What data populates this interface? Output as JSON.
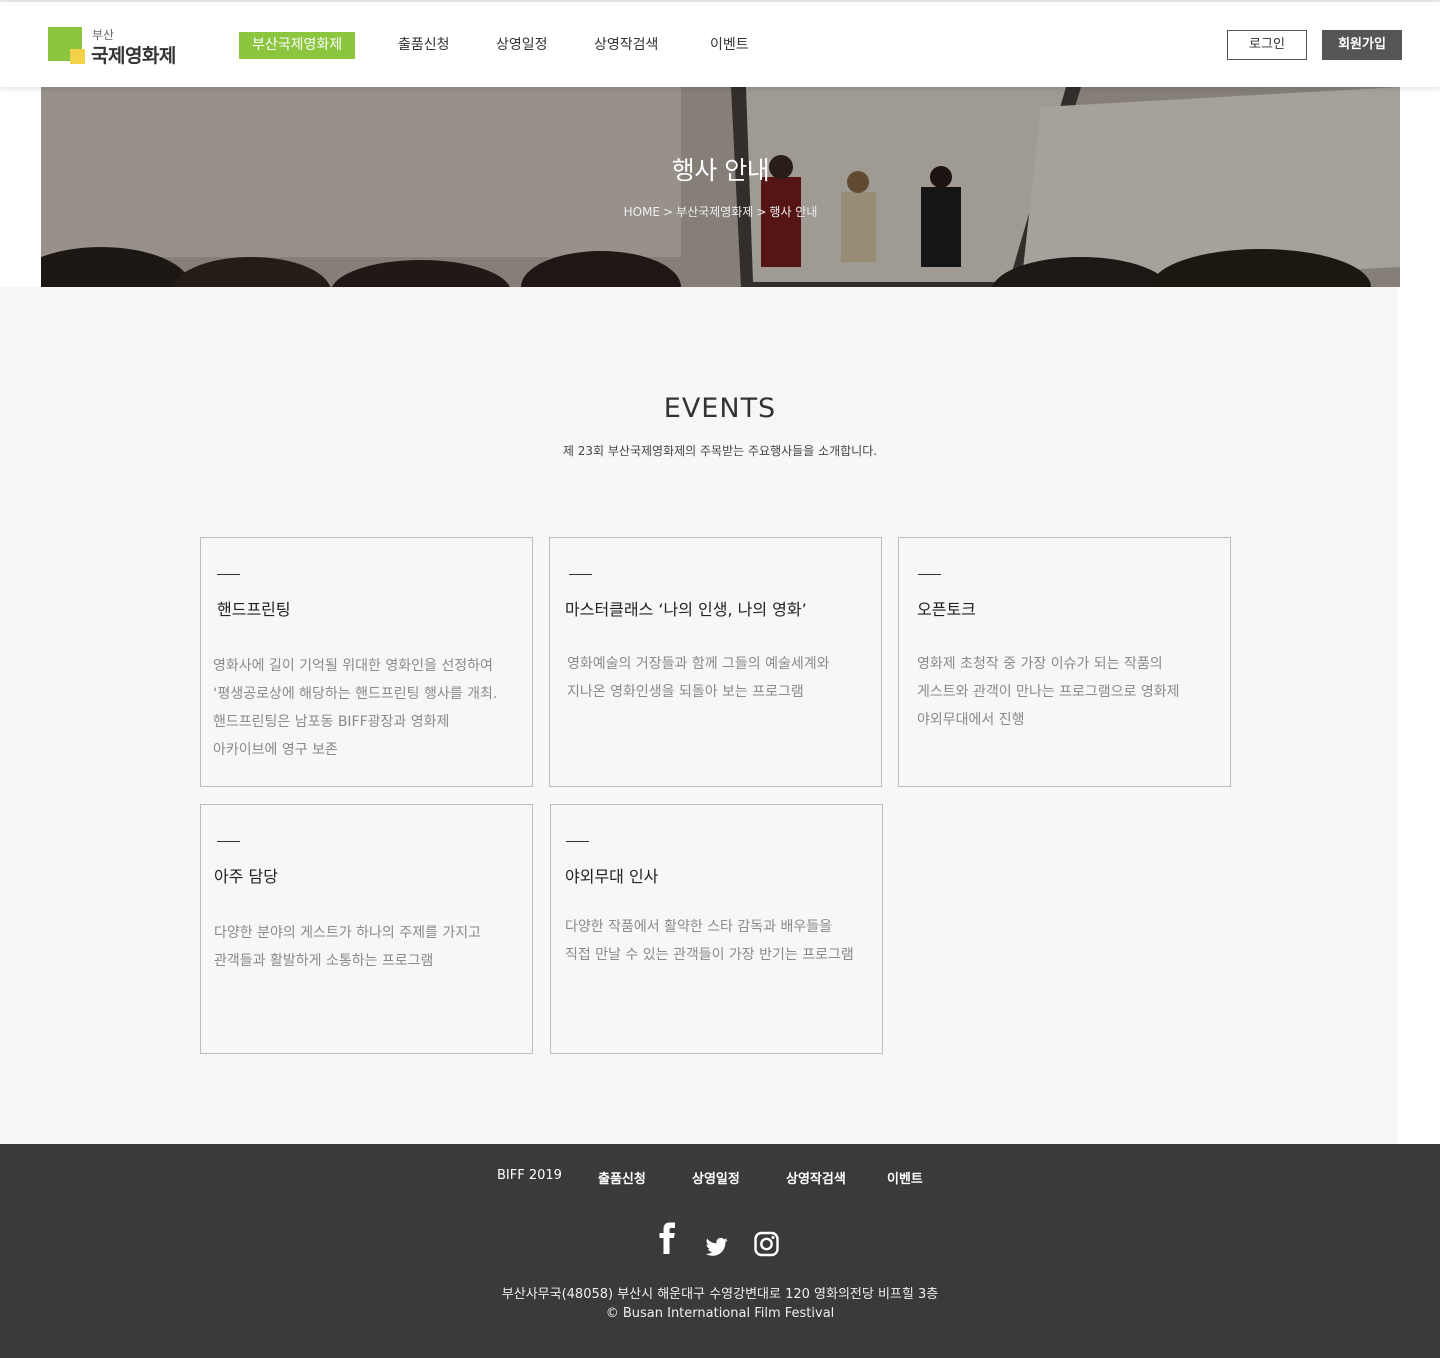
{
  "header": {
    "logo_small": "부산",
    "logo_big": "국제영화제",
    "nav": [
      {
        "label": "부산국제영화제",
        "active": true
      },
      {
        "label": "출품신청",
        "active": false
      },
      {
        "label": "상영일정",
        "active": false
      },
      {
        "label": "상영작검색",
        "active": false
      },
      {
        "label": "이벤트",
        "active": false
      }
    ],
    "login_label": "로그인",
    "join_label": "회원가입",
    "accent_color": "#8cc63f"
  },
  "hero": {
    "title": "행사 안내",
    "breadcrumb": [
      "HOME",
      "부산국제영화제",
      "행사 안내"
    ]
  },
  "events": {
    "title": "EVENTS",
    "subtitle": "제 23회 부산국제영화제의 주목받는 주요행사들을 소개합니다.",
    "cards": [
      {
        "title": "핸드프린팅",
        "desc": "영화사에 길이 기억될 위대한 영화인을 선정하여\n‘평생공로상에 해당하는 핸드프린팅 행사를 개최.\n핸드프린팅은 남포동 BIFF광장과 영화제\n아카이브에 영구 보존"
      },
      {
        "title": "마스터클래스 ‘나의 인생, 나의 영화’",
        "desc": "영화예술의 거장들과 함께 그들의 예술세계와\n지나온 영화인생을 되돌아 보는 프로그램"
      },
      {
        "title": "오픈토크",
        "desc": "영화제 초청작 중 가장 이슈가 되는 작품의\n게스트와 관객이 만나는 프로그램으로 영화제\n야외무대에서 진행"
      },
      {
        "title": "아주 담당",
        "desc": "다양한 분야의 게스트가 하나의 주제를 가지고\n관객들과 활발하게 소통하는 프로그램"
      },
      {
        "title": "야외무대 인사",
        "desc": "다양한 작품에서 활약한 스타 감독과 배우들을\n직접 만날 수 있는 관객들이 가장 반기는 프로그램"
      }
    ]
  },
  "footer": {
    "nav": [
      "BIFF 2019",
      "출품신청",
      "상영일정",
      "상영작검색",
      "이벤트"
    ],
    "social": [
      "facebook-icon",
      "twitter-icon",
      "instagram-icon"
    ],
    "address": "부산사무국(48058) 부산시 해운대구 수영강변대로 120 영화의전당 비프힐 3층",
    "copyright": "© Busan International Film Festival"
  }
}
